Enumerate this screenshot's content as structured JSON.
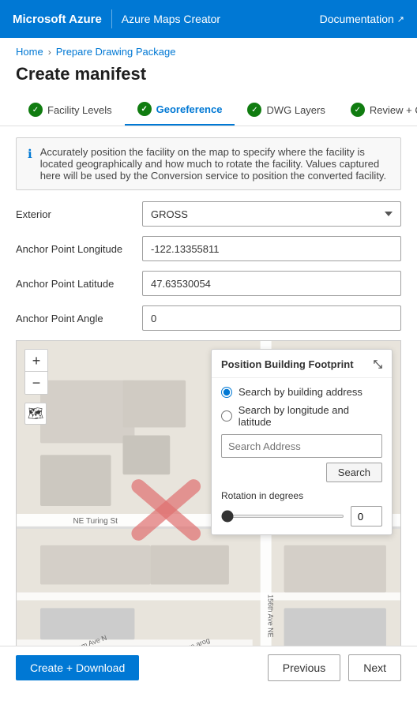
{
  "topnav": {
    "brand": "Microsoft Azure",
    "product": "Azure Maps Creator",
    "doc_link": "Documentation",
    "doc_icon": "↗"
  },
  "breadcrumb": {
    "home": "Home",
    "current": "Prepare Drawing Package"
  },
  "page": {
    "title": "Create manifest"
  },
  "steps": [
    {
      "id": "facility-levels",
      "label": "Facility Levels",
      "checked": true,
      "active": false
    },
    {
      "id": "georeference",
      "label": "Georeference",
      "checked": true,
      "active": true
    },
    {
      "id": "dwg-layers",
      "label": "DWG Layers",
      "checked": true,
      "active": false
    },
    {
      "id": "review-create",
      "label": "Review + Create",
      "checked": true,
      "active": false
    }
  ],
  "info_text": "Accurately position the facility on the map to specify where the facility is located geographically and how much to rotate the facility. Values captured here will be used by the Conversion service to position the converted facility.",
  "form": {
    "exterior_label": "Exterior",
    "exterior_value": "GROSS",
    "anchor_lng_label": "Anchor Point Longitude",
    "anchor_lng_value": "-122.13355811",
    "anchor_lat_label": "Anchor Point Latitude",
    "anchor_lat_value": "47.63530054",
    "anchor_angle_label": "Anchor Point Angle",
    "anchor_angle_value": "0"
  },
  "position_panel": {
    "title": "Position Building Footprint",
    "collapse_icon": "⤡",
    "radio1": "Search by building address",
    "radio2": "Search by longitude and latitude",
    "search_placeholder": "Search Address",
    "search_btn": "Search",
    "rotation_label": "Rotation in degrees",
    "rotation_value": "0"
  },
  "bottom_bar": {
    "create_download": "Create + Download",
    "previous": "Previous",
    "next": "Next"
  }
}
